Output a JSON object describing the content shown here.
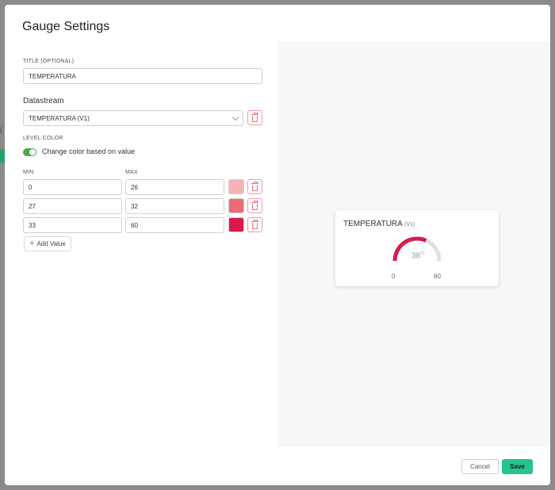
{
  "backdrop": {
    "partial_letter": "l"
  },
  "dialog": {
    "title": "Gauge Settings",
    "title_field": {
      "label": "TITLE (OPTIONAL)",
      "value": "TEMPERATURA"
    },
    "datastream": {
      "label": "Datastream",
      "selected": "TEMPERATURA (V1)"
    },
    "level_color": {
      "label": "LEVEL COLOR",
      "toggle_label": "Change color based on value",
      "toggle_on": true
    },
    "ranges_header": {
      "min": "MIN",
      "max": "MAX"
    },
    "ranges": [
      {
        "min": "0",
        "max": "26",
        "color": "#f5b3b6"
      },
      {
        "min": "27",
        "max": "32",
        "color": "#ef6a77"
      },
      {
        "min": "33",
        "max": "60",
        "color": "#d81b4c"
      }
    ],
    "add_value_label": "Add Value",
    "cancel_label": "Cancel",
    "save_label": "Save"
  },
  "preview": {
    "title": "TEMPERATURA",
    "datastream": "(V1)",
    "value": "38",
    "unit": "°C",
    "min": "0",
    "max": "60",
    "value_fraction": 0.633,
    "arc_color": "#d81b4c",
    "track_color": "#e0e0e0"
  }
}
